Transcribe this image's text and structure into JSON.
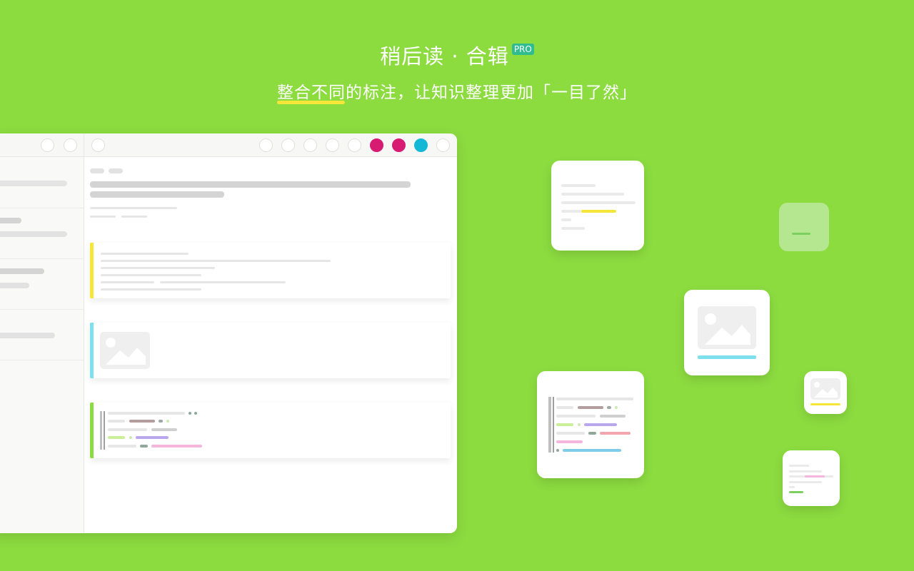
{
  "header": {
    "title": "稍后读 · 合辑",
    "badge": "PRO",
    "subtitle": "整合不同的标注，让知识整理更加「一目了然」"
  },
  "colors": {
    "background": "#8cdc40",
    "highlight_yellow": "#f7e63a",
    "highlight_cyan": "#7ee0ec",
    "highlight_green": "#8cdc40",
    "tag_magenta": "#d81b72",
    "tag_cyan": "#13b8d6",
    "badge_green": "#2fbc8e"
  },
  "toolbar": {
    "buttons": [
      "white-circle",
      "white-circle",
      "white-circle",
      "white-circle",
      "white-circle",
      "magenta-circle",
      "magenta-circle",
      "cyan-circle",
      "white-circle"
    ]
  },
  "icons": [
    "image-placeholder-icon",
    "code-block-icon",
    "text-block-icon"
  ]
}
